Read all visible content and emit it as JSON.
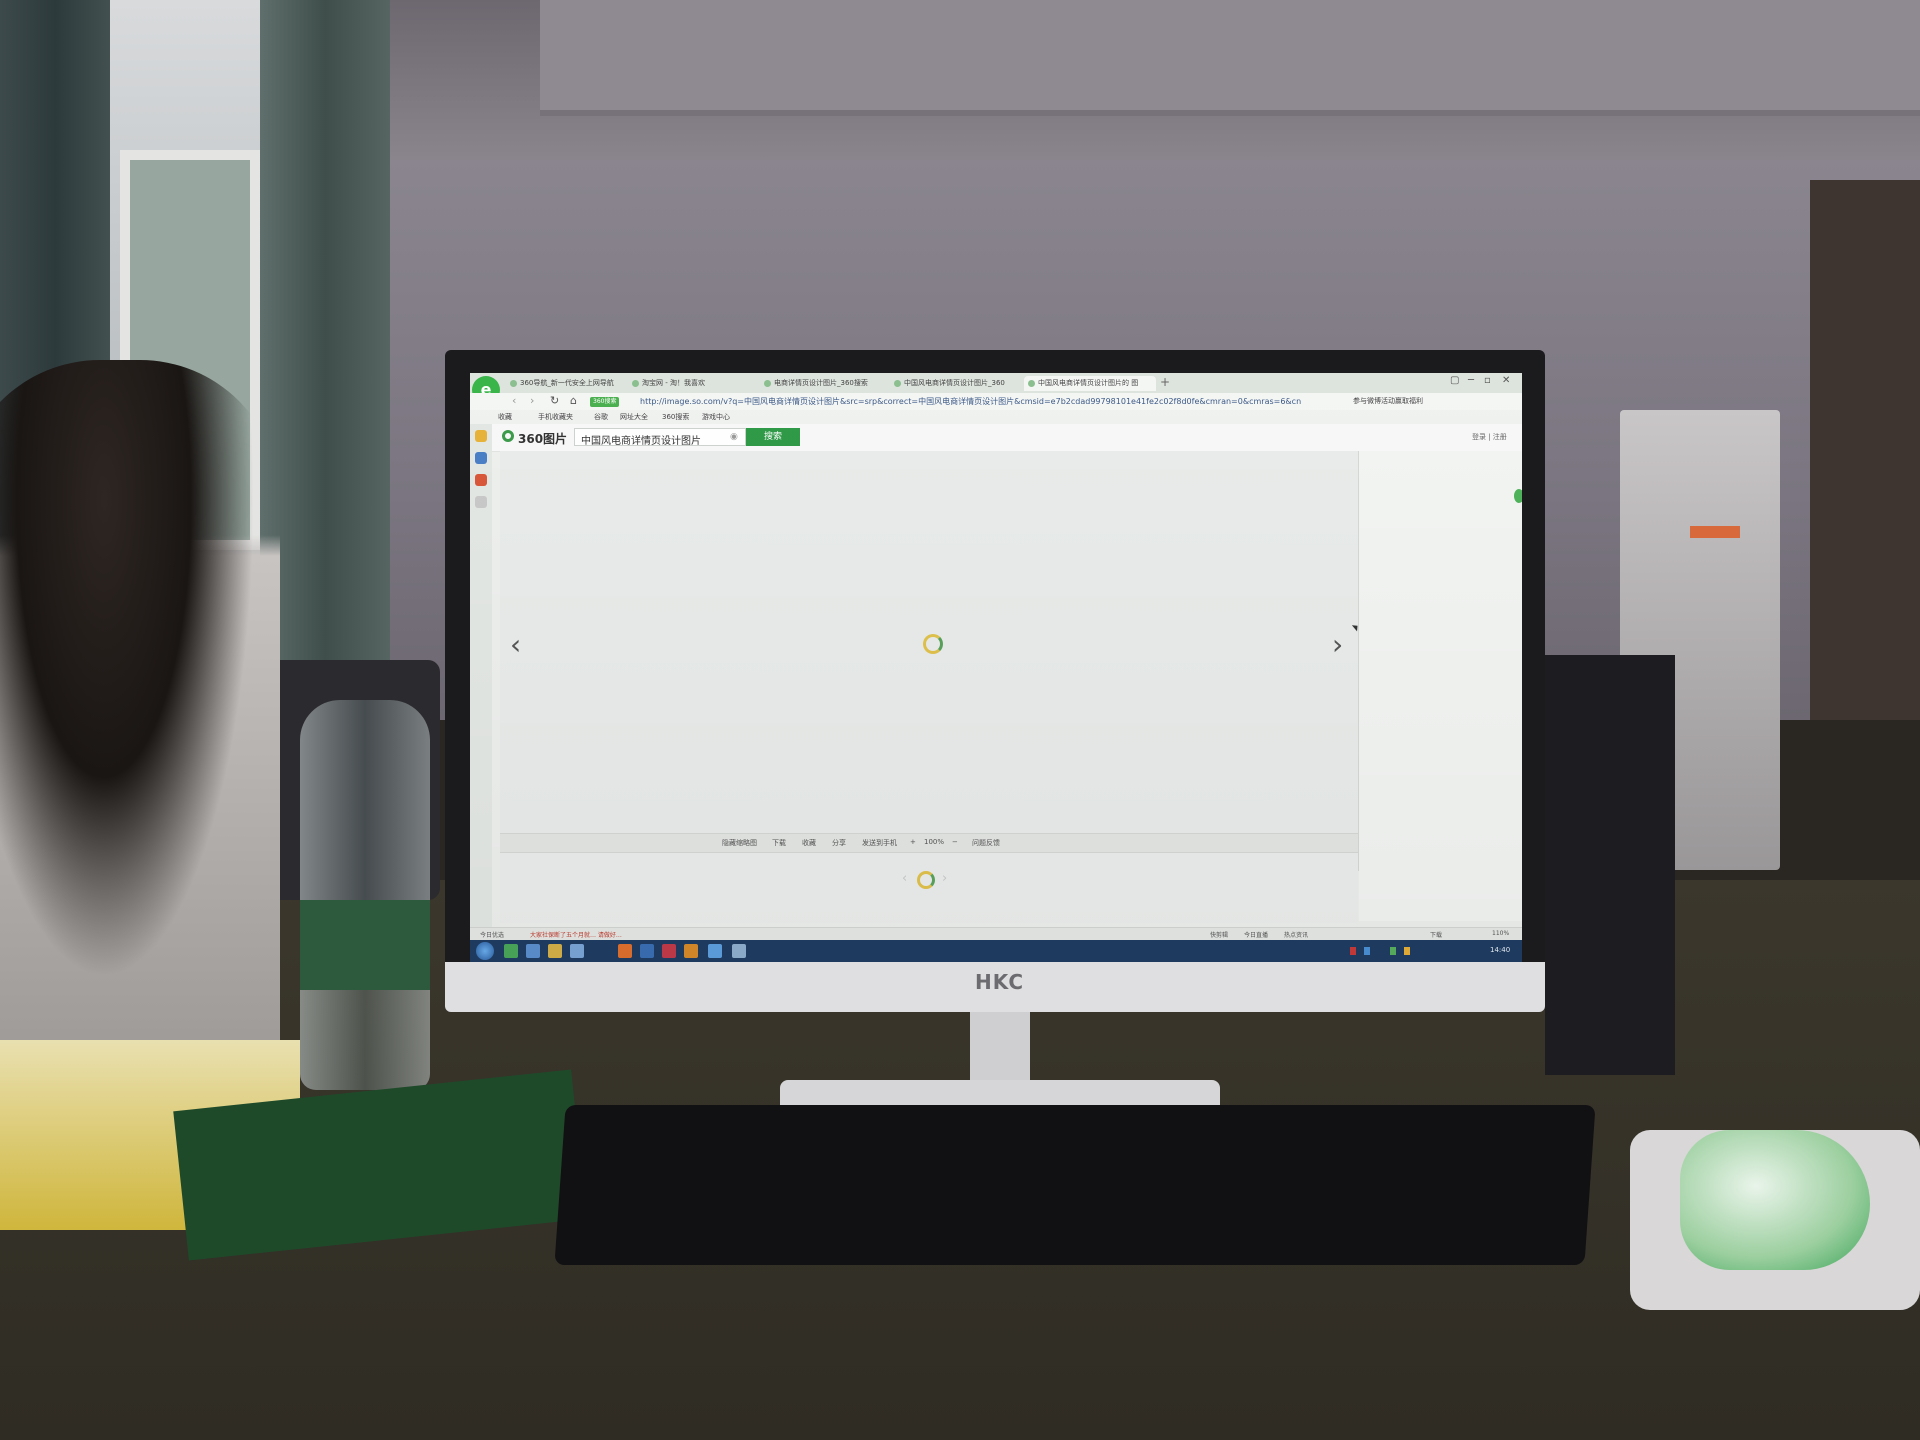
{
  "monitor": {
    "brand": "HKC"
  },
  "browser": {
    "logo_glyph": "e",
    "tabs": [
      {
        "label": "360导航_新一代安全上网导航"
      },
      {
        "label": "淘宝网 - 淘！我喜欢"
      },
      {
        "label": "电商详情页设计图片_360搜索"
      },
      {
        "label": "中国风电商详情页设计图片_360"
      },
      {
        "label": "中国风电商详情页设计图片的 图",
        "active": true
      }
    ],
    "new_tab": "+",
    "window_controls": [
      "▢",
      "─",
      "▫",
      "✕"
    ],
    "nav": {
      "back": "‹",
      "forward": "›",
      "reload": "↻",
      "home": "⌂"
    },
    "address": {
      "badge": "360搜索",
      "url": "http://image.so.com/v?q=中国风电商详情页设计图片&src=srp&correct=中国风电商详情页设计图片&cmsid=e7b2cdad99798101e41fe2c02f8d0fe&cmran=0&cmras=6&cn",
      "right_text": "参与微博活动赢取福利"
    },
    "favorites": [
      "收藏",
      "手机收藏夹",
      "谷歌",
      "网址大全",
      "360搜索",
      "游戏中心"
    ]
  },
  "page": {
    "logo": "360图片",
    "search": {
      "value": "中国风电商详情页设计图片",
      "button": "搜索"
    },
    "account": "登录 | 注册",
    "viewer": {
      "prev": "‹",
      "next": "›"
    },
    "toolbar": {
      "items": [
        "隐藏缩略图",
        "下载",
        "收藏",
        "分享",
        "发送到手机",
        "+",
        "100%",
        "−",
        "问题反馈"
      ]
    }
  },
  "status_bar": {
    "left": [
      "今日优选",
      "大家社保断了五个月就…  请做好…"
    ],
    "right": [
      "快剪辑",
      "今日直播",
      "热点资讯",
      "下载",
      "110%"
    ]
  },
  "taskbar": {
    "clock": "14:40"
  }
}
